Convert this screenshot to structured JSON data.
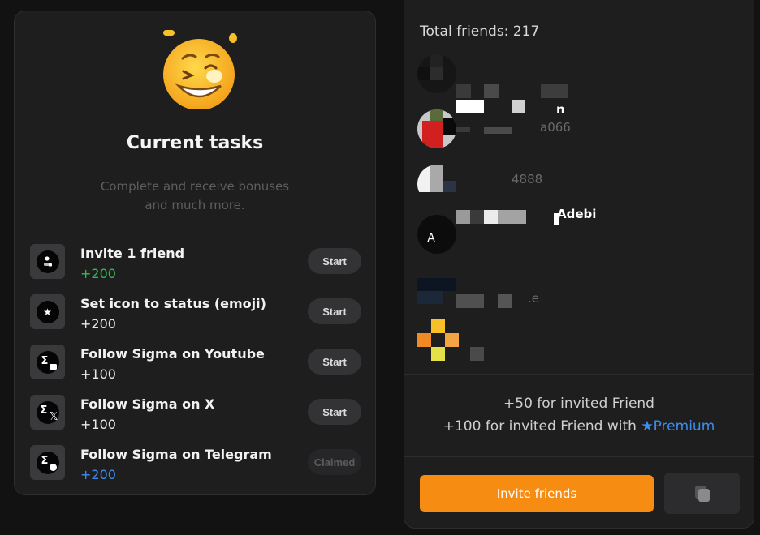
{
  "tasks_panel": {
    "title": "Current tasks",
    "subtitle_line1": "Complete and receive bonuses",
    "subtitle_line2": "and much more.",
    "emoji_icon": "winking-grin-emoji",
    "tasks": [
      {
        "name": "Invite 1 friend",
        "reward": "+200",
        "reward_color": "#2fbf4a",
        "icon": "invite-friend-icon",
        "button": "Start",
        "state": "available"
      },
      {
        "name": "Set icon to status (emoji)",
        "reward": "+200",
        "reward_color": "#e8e8e8",
        "icon": "star-icon",
        "button": "Start",
        "state": "available"
      },
      {
        "name": "Follow Sigma on Youtube",
        "reward": "+100",
        "reward_color": "#e8e8e8",
        "icon": "sigma-youtube-icon",
        "button": "Start",
        "state": "available"
      },
      {
        "name": "Follow Sigma on X",
        "reward": "+100",
        "reward_color": "#e8e8e8",
        "icon": "sigma-x-icon",
        "button": "Start",
        "state": "available"
      },
      {
        "name": "Follow Sigma on Telegram",
        "reward": "+200",
        "reward_color": "#3d8ef0",
        "icon": "sigma-telegram-icon",
        "button": "Claimed",
        "state": "claimed"
      }
    ]
  },
  "friends_panel": {
    "total_label": "Total friends: 217",
    "friends": [
      {
        "name_visible": "",
        "handle_visible": ""
      },
      {
        "name_visible": "n",
        "handle_visible": "a066"
      },
      {
        "name_visible": "",
        "handle_visible": "4888"
      },
      {
        "name_visible": "Adebi",
        "handle_visible": "",
        "avatar_letter": "A"
      },
      {
        "name_visible": "",
        "handle_visible": ".e"
      },
      {
        "name_visible": "",
        "handle_visible": ""
      }
    ],
    "bonus_line1": "+50 for invited Friend",
    "bonus_line2_prefix": "+100 for invited Friend with",
    "bonus_line2_premium": "Premium",
    "invite_button": "Invite friends",
    "copy_button_icon": "copy-icon"
  },
  "colors": {
    "accent_orange": "#f78c12",
    "premium_blue": "#3d8ef0",
    "reward_green": "#2fbf4a"
  }
}
